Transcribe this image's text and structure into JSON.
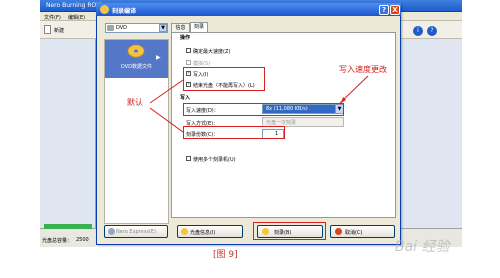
{
  "app": {
    "title": "Nero Burning ROM",
    "menu": [
      "文件(F)",
      "编辑(E)"
    ],
    "toolbar_new": "新建",
    "capacity_label": "光盘总容量：",
    "capacity_value": "2500"
  },
  "dialog": {
    "title": "刻录编译",
    "help_label": "?",
    "close_label": "X",
    "drive": "DVD",
    "task_label": "DVD数据文件",
    "tabs": [
      "信息",
      "刻录"
    ],
    "operations": {
      "heading": "操作",
      "options": [
        {
          "label": "确定最大速度(Z)",
          "checked": false,
          "disabled": false
        },
        {
          "label": "模拟(S)",
          "checked": false,
          "disabled": true
        },
        {
          "label": "写入(I)",
          "checked": true,
          "disabled": false
        },
        {
          "label": "结束光盘（不能再写入）(L)",
          "checked": true,
          "disabled": false
        }
      ]
    },
    "write": {
      "heading": "写入",
      "speed_label": "写入速度(D)：",
      "speed_value": "8x (11,080 KB/s)",
      "method_label": "写入方式(E)：",
      "method_value": "光盘一次刻录",
      "copies_label": "刻录份数(C)：",
      "copies_value": "1",
      "multi_recorder_label": "使用多个刻录机(U)"
    },
    "buttons": {
      "express": "Nero Express(E)",
      "disc_image": "光盘信息(I)",
      "burn": "刻录(B)",
      "cancel": "取消(C)"
    }
  },
  "annotations": {
    "default_note": "默认",
    "speed_note": "写入速度更改"
  },
  "caption": "[图 9]",
  "watermark": "Bai 经验",
  "colors": {
    "annotation_red": "#d42020",
    "titlebar_blue": "#1b55cf",
    "dialog_bg": "#ece9d8",
    "task_selected": "#5577c8"
  }
}
